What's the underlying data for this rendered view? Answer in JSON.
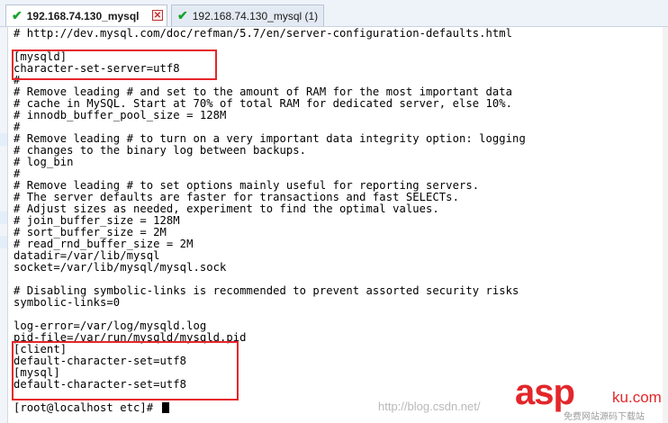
{
  "tabs": [
    {
      "label": "192.168.74.130_mysql",
      "active": true
    },
    {
      "label": "192.168.74.130_mysql (1)",
      "active": false
    }
  ],
  "terminal": {
    "lines": [
      "# http://dev.mysql.com/doc/refman/5.7/en/server-configuration-defaults.html",
      "",
      "[mysqld]",
      "character-set-server=utf8",
      "#",
      "# Remove leading # and set to the amount of RAM for the most important data",
      "# cache in MySQL. Start at 70% of total RAM for dedicated server, else 10%.",
      "# innodb_buffer_pool_size = 128M",
      "#",
      "# Remove leading # to turn on a very important data integrity option: logging",
      "# changes to the binary log between backups.",
      "# log_bin",
      "#",
      "# Remove leading # to set options mainly useful for reporting servers.",
      "# The server defaults are faster for transactions and fast SELECTs.",
      "# Adjust sizes as needed, experiment to find the optimal values.",
      "# join_buffer_size = 128M",
      "# sort_buffer_size = 2M",
      "# read_rnd_buffer_size = 2M",
      "datadir=/var/lib/mysql",
      "socket=/var/lib/mysql/mysql.sock",
      "",
      "# Disabling symbolic-links is recommended to prevent assorted security risks",
      "symbolic-links=0",
      "",
      "log-error=/var/log/mysqld.log",
      "pid-file=/var/run/mysqld/mysqld.pid",
      "[client]",
      "default-character-set=utf8",
      "[mysql]",
      "default-character-set=utf8",
      "",
      "[root@localhost etc]# "
    ]
  },
  "watermark": "http://blog.csdn.net/",
  "brand": {
    "word": "asp",
    "tld": "ku",
    "suffix": ".com",
    "sub": "免费网站源码下载站"
  },
  "colors": {
    "highlight": "#e5262a",
    "check": "#17a22b",
    "brand": "#e3262a"
  }
}
